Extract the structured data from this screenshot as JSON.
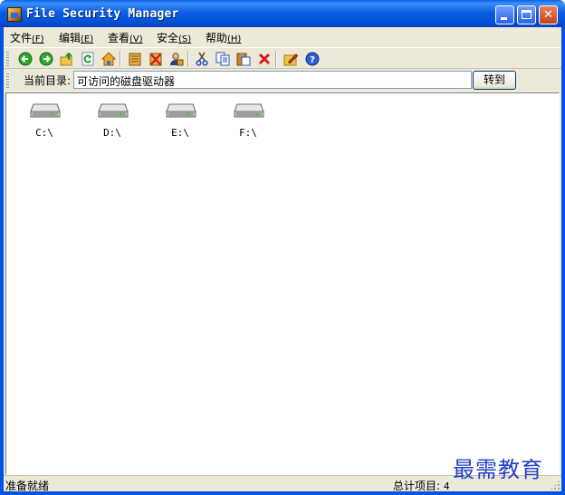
{
  "window": {
    "title": "File Security Manager",
    "title_color": "#ffffff",
    "titlebar_color": "#0054e3"
  },
  "menu": [
    {
      "label": "文件",
      "accel": "(F)"
    },
    {
      "label": "编辑",
      "accel": "(E)"
    },
    {
      "label": "查看",
      "accel": "(V)"
    },
    {
      "label": "安全",
      "accel": "(S)"
    },
    {
      "label": "帮助",
      "accel": "(H)"
    }
  ],
  "toolbar": {
    "icons": [
      "back-icon",
      "forward-icon",
      "up-folder-icon",
      "refresh-icon",
      "home-icon",
      "encrypt-icon",
      "decrypt-icon",
      "user-lock-icon",
      "cut-icon",
      "copy-icon",
      "paste-icon",
      "delete-icon",
      "properties-icon",
      "help-icon"
    ]
  },
  "address": {
    "label": "当前目录:",
    "value": "可访问的磁盘驱动器",
    "go_button": "转到"
  },
  "drives": [
    {
      "label": "C:\\"
    },
    {
      "label": "D:\\"
    },
    {
      "label": "E:\\"
    },
    {
      "label": "F:\\"
    }
  ],
  "status": {
    "left": "准备就绪",
    "right_label": "总计项目:",
    "count": "4"
  },
  "watermark": "最需教育",
  "colors": {
    "face": "#ece9d8",
    "watermark": "#2340c4"
  }
}
